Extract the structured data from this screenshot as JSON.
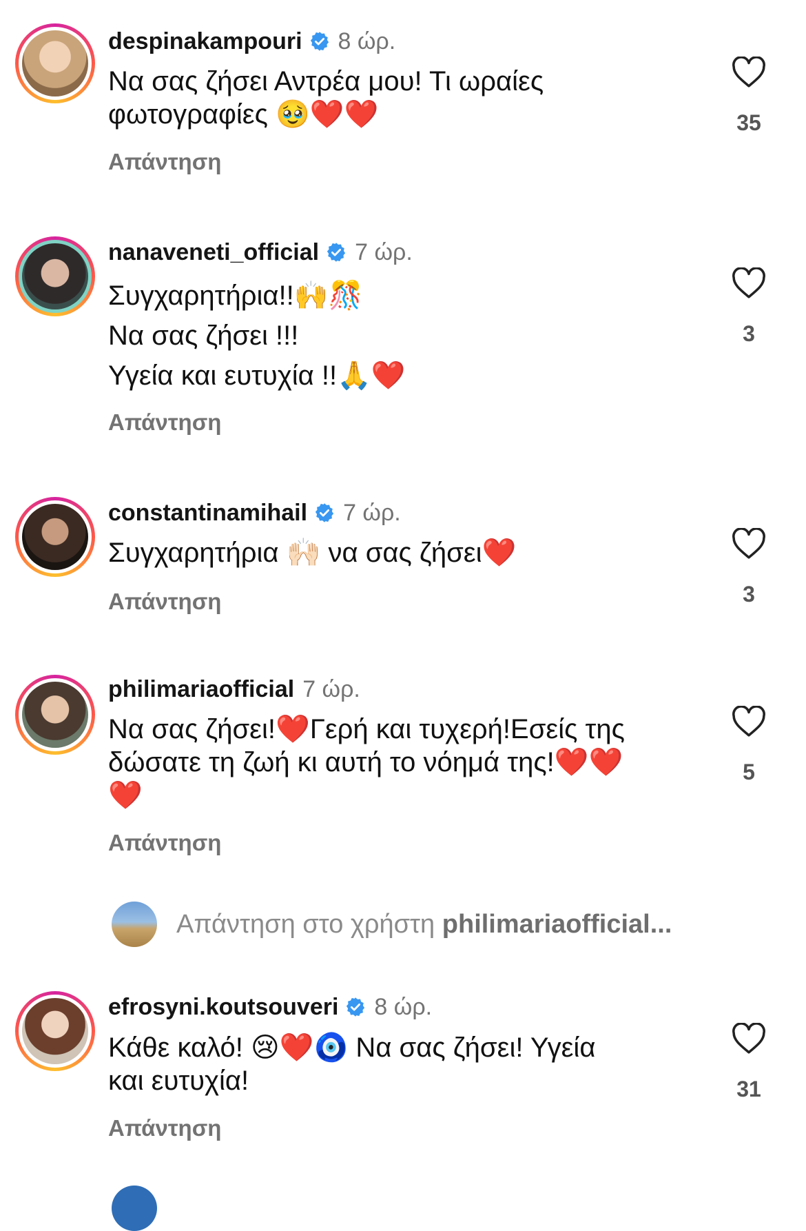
{
  "comments": [
    {
      "username": "despinakampouri",
      "verified": true,
      "time": "8 ώρ.",
      "lines": [
        "Να σας ζήσει Αντρέα μου! Τι ωραίες",
        "φωτογραφίες 🥹❤️❤️"
      ],
      "reply_label": "Απάντηση",
      "likes": "35",
      "avatar_color": "#c9a47a"
    },
    {
      "username": "nanaveneti_official",
      "verified": true,
      "time": "7 ώρ.",
      "lines": [
        "Συγχαρητήρια!!🙌🎊",
        "Να σας ζήσει !!!",
        "Υγεία και ευτυχία !!🙏❤️"
      ],
      "reply_label": "Απάντηση",
      "likes": "3",
      "avatar_color": "#3a4f4c"
    },
    {
      "username": "constantinamihail",
      "verified": true,
      "time": "7 ώρ.",
      "lines": [
        "Συγχαρητήρια 🙌🏻 να σας ζήσει❤️"
      ],
      "reply_label": "Απάντηση",
      "likes": "3",
      "avatar_color": "#3b2a22"
    },
    {
      "username": "philimariaofficial",
      "verified": false,
      "time": "7 ώρ.",
      "lines": [
        "Να σας ζήσει!❤️Γερή και τυχερή!Εσείς της",
        "δώσατε τη ζωή κι αυτή το νόημά της!❤️❤️",
        "❤️"
      ],
      "reply_label": "Απάντηση",
      "likes": "5",
      "avatar_color": "#4a3a30"
    },
    {
      "username": "efrosyni.koutsouveri",
      "verified": true,
      "time": "8 ώρ.",
      "lines": [
        "Κάθε καλό! 😢❤️🧿 Να σας ζήσει! Υγεία",
        "και ευτυχία!"
      ],
      "reply_label": "Απάντηση",
      "likes": "31",
      "avatar_color": "#b58a6a"
    }
  ],
  "reply_box": {
    "prefix": "Απάντηση στο χρήστη",
    "target": "philimariaofficial..."
  },
  "colors": {
    "verified": "#3897f0",
    "muted": "#737373"
  }
}
